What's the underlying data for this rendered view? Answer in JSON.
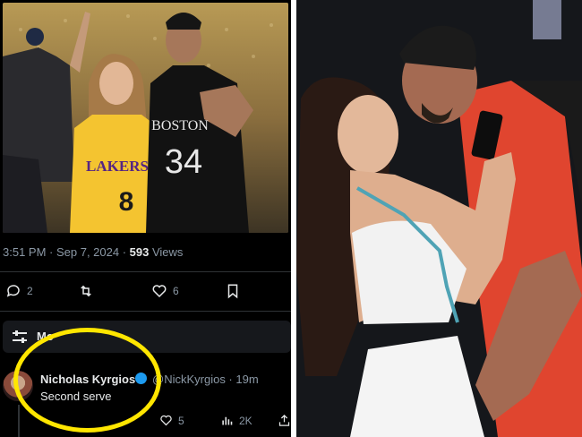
{
  "tweet": {
    "time": "3:51 PM",
    "sep": " · ",
    "date": "Sep 7, 2024",
    "sep2": " · ",
    "views_count": "593",
    "views_label": " Views",
    "replies": "2",
    "likes": "6"
  },
  "photo_text": {
    "jersey_left": "LAKERS",
    "jersey_left_number": "8",
    "jersey_right": "BOSTON",
    "jersey_right_number": "34"
  },
  "more_bar": {
    "label": "Mo"
  },
  "reply": {
    "name": "Nicholas Kyrgios",
    "handle": "@NickKyrgios · 19m",
    "text": "Second serve",
    "likes": "5",
    "views": "2K"
  },
  "colors": {
    "highlight": "#ffe600",
    "verified": "#1d9bf0"
  }
}
